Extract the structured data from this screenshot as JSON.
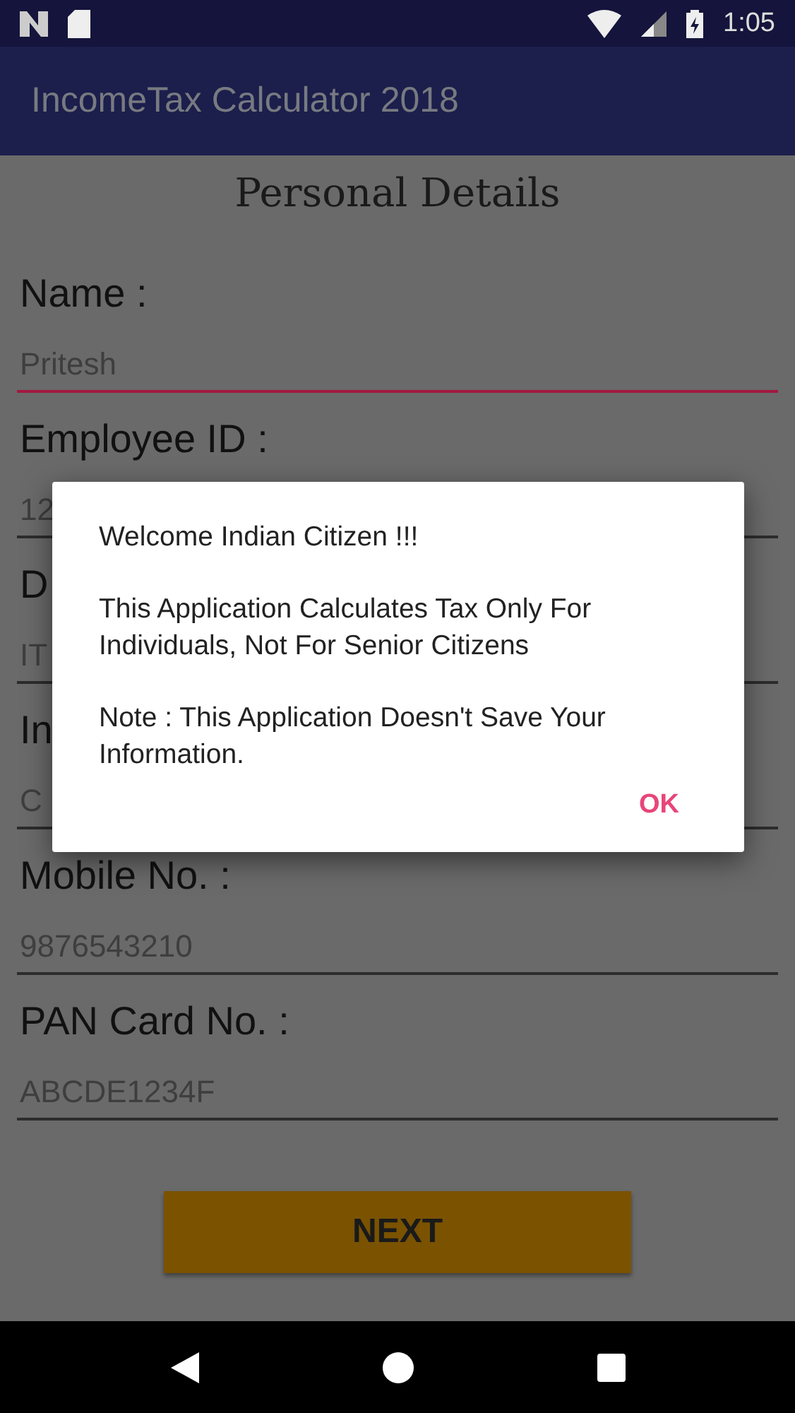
{
  "status_bar": {
    "time": "1:05"
  },
  "app_bar": {
    "title": "IncomeTax Calculator 2018"
  },
  "heading": "Personal Details",
  "fields": [
    {
      "label": "Name :",
      "value": "Pritesh",
      "focused": true
    },
    {
      "label": "Employee ID :",
      "value": "12",
      "focused": false
    },
    {
      "label": "D",
      "value": "IT",
      "focused": false
    },
    {
      "label": "In",
      "value": "C",
      "focused": false
    },
    {
      "label": "Mobile No. :",
      "value": "9876543210",
      "focused": false
    },
    {
      "label": "PAN Card No. :",
      "value": "ABCDE1234F",
      "focused": false
    }
  ],
  "next_button": "NEXT",
  "dialog": {
    "paragraphs": [
      "Welcome Indian Citizen !!!",
      "This Application Calculates Tax Only For Individuals, Not For Senior Citizens",
      "Note : This Application Doesn't Save Your Information."
    ],
    "button": "OK"
  }
}
